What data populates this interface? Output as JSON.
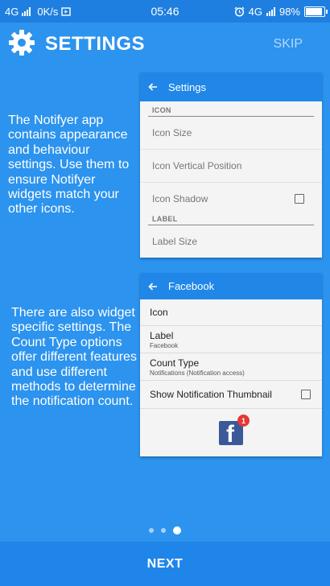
{
  "status_bar": {
    "network": "4G",
    "speed": "0K/s",
    "time": "05:46",
    "network_right": "4G",
    "battery": "98%",
    "battery_level": 0.98
  },
  "header": {
    "title": "SETTINGS",
    "skip_label": "SKIP",
    "icon": "gear-icon"
  },
  "descriptions": [
    "The Notifyer app contains appearance and behaviour settings. Use them to ensure Notifyer widgets match your other icons.",
    "There are also widget specific settings. The Count Type options offer different features and use different methods to determine the notification count."
  ],
  "settings_card": {
    "title": "Settings",
    "section_icon": "ICON",
    "items": [
      "Icon Size",
      "Icon Vertical Position",
      "Icon Shadow"
    ],
    "section_label": "LABEL",
    "label_items": [
      "Label Size"
    ]
  },
  "facebook_card": {
    "title": "Facebook",
    "items": [
      {
        "label": "Icon",
        "sub": ""
      },
      {
        "label": "Label",
        "sub": "Facebook"
      },
      {
        "label": "Count Type",
        "sub": "Notifications (Notification access)"
      },
      {
        "label": "Show Notification Thumbnail",
        "sub": ""
      }
    ],
    "badge_count": "1",
    "logo_letter": "f"
  },
  "pagination": {
    "count": 3,
    "active": 2
  },
  "footer": {
    "next_label": "NEXT"
  },
  "colors": {
    "background": "#2c93ee",
    "status_bar": "#1f7fe0",
    "card_bar": "#2087e8",
    "facebook": "#3b5998",
    "badge": "#e53935"
  }
}
